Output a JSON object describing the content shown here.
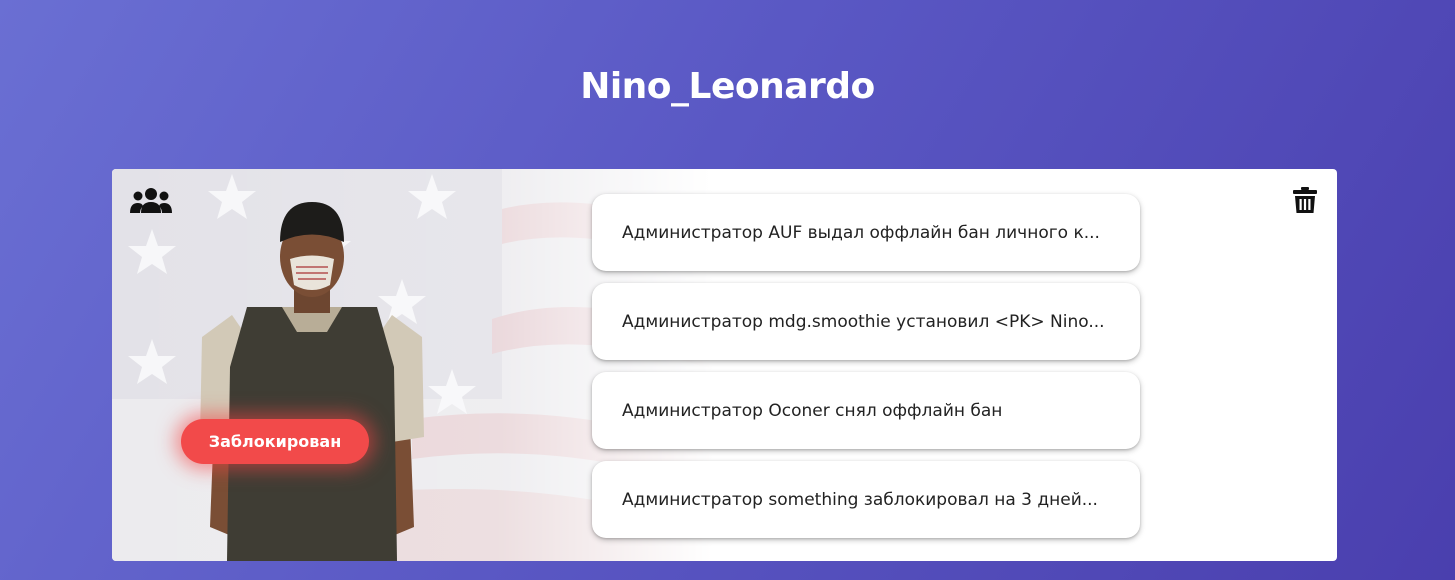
{
  "profile": {
    "name": "Nino_Leonardo",
    "status": "Заблокирован"
  },
  "icons": {
    "group": "users-group-icon",
    "delete": "trash-icon"
  },
  "colors": {
    "status_badge": "#f24a4a",
    "background_start": "#6a6fd3",
    "background_end": "#4a3fae"
  },
  "logs": [
    "Администратор AUF выдал оффлайн бан личного к...",
    "Администратор mdg.smoothie установил <PK> Nino...",
    "Администратор Oconer снял оффлайн бан",
    "Администратор something заблокировал на 3 дней..."
  ]
}
